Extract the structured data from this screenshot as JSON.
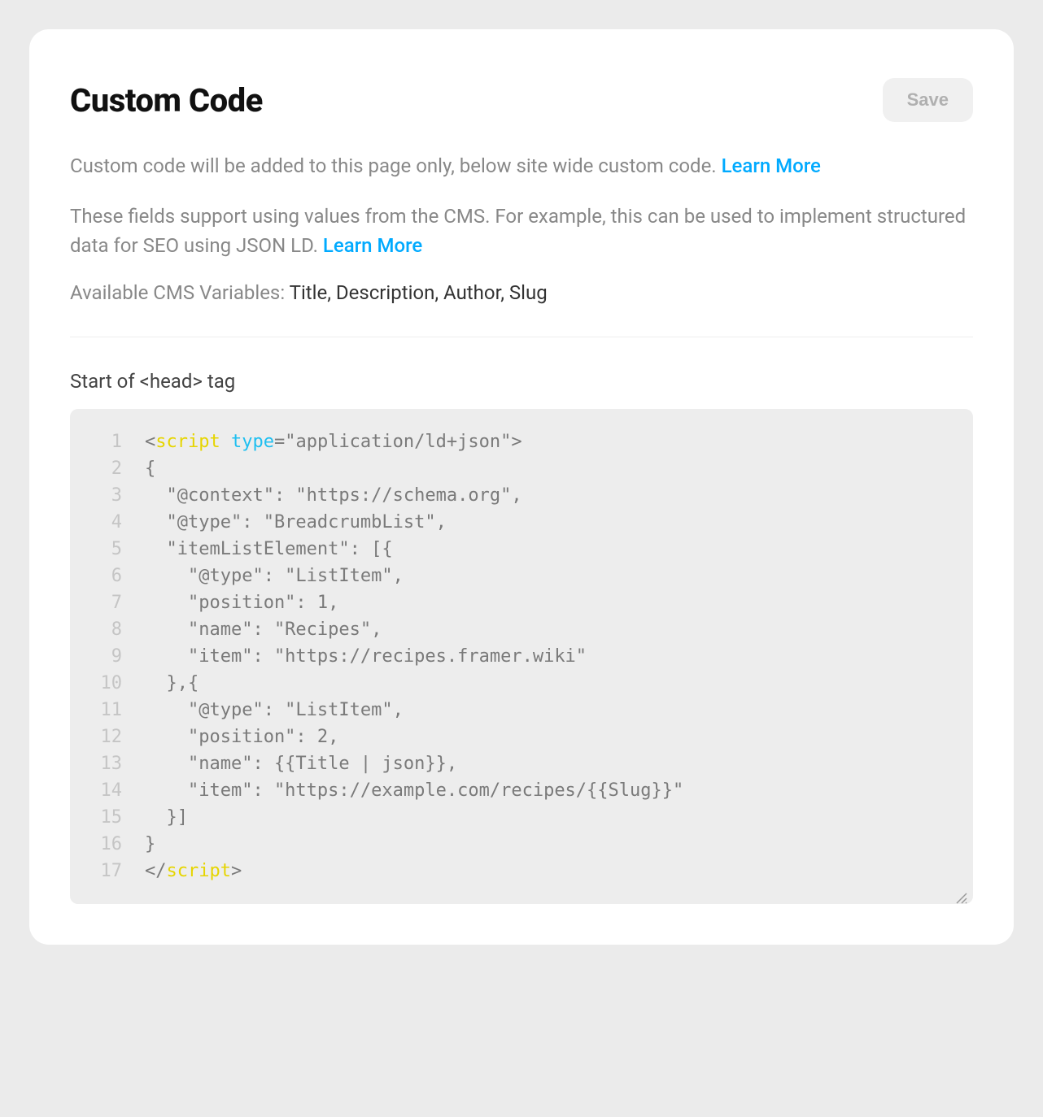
{
  "header": {
    "title": "Custom Code",
    "save_label": "Save"
  },
  "descriptions": {
    "line1": "Custom code will be added to this page only, below site wide custom code. ",
    "learn_more_1": "Learn More",
    "line2": "These fields support using values from the CMS. For example, this can be used to implement structured data for SEO using JSON LD. ",
    "learn_more_2": "Learn More"
  },
  "cms_vars": {
    "label": "Available CMS Variables: ",
    "value": "Title, Description, Author, Slug"
  },
  "section_label": "Start of <head> tag",
  "code": {
    "lines": [
      {
        "n": "1",
        "segments": [
          {
            "t": "<",
            "c": "plain"
          },
          {
            "t": "script",
            "c": "tag"
          },
          {
            "t": " ",
            "c": "plain"
          },
          {
            "t": "type",
            "c": "attr"
          },
          {
            "t": "=\"application/ld+json\">",
            "c": "plain"
          }
        ]
      },
      {
        "n": "2",
        "segments": [
          {
            "t": "{",
            "c": "plain"
          }
        ]
      },
      {
        "n": "3",
        "segments": [
          {
            "t": "  \"@context\": \"https://schema.org\",",
            "c": "plain"
          }
        ]
      },
      {
        "n": "4",
        "segments": [
          {
            "t": "  \"@type\": \"BreadcrumbList\",",
            "c": "plain"
          }
        ]
      },
      {
        "n": "5",
        "segments": [
          {
            "t": "  \"itemListElement\": [{",
            "c": "plain"
          }
        ]
      },
      {
        "n": "6",
        "segments": [
          {
            "t": "    \"@type\": \"ListItem\",",
            "c": "plain"
          }
        ]
      },
      {
        "n": "7",
        "segments": [
          {
            "t": "    \"position\": 1,",
            "c": "plain"
          }
        ]
      },
      {
        "n": "8",
        "segments": [
          {
            "t": "    \"name\": \"Recipes\",",
            "c": "plain"
          }
        ]
      },
      {
        "n": "9",
        "segments": [
          {
            "t": "    \"item\": \"https://recipes.framer.wiki\"",
            "c": "plain"
          }
        ]
      },
      {
        "n": "10",
        "segments": [
          {
            "t": "  },{",
            "c": "plain"
          }
        ]
      },
      {
        "n": "11",
        "segments": [
          {
            "t": "    \"@type\": \"ListItem\",",
            "c": "plain"
          }
        ]
      },
      {
        "n": "12",
        "segments": [
          {
            "t": "    \"position\": 2,",
            "c": "plain"
          }
        ]
      },
      {
        "n": "13",
        "segments": [
          {
            "t": "    \"name\": {{Title | json}},",
            "c": "plain"
          }
        ]
      },
      {
        "n": "14",
        "segments": [
          {
            "t": "    \"item\": \"https://example.com/recipes/{{Slug}}\"",
            "c": "plain"
          }
        ]
      },
      {
        "n": "15",
        "segments": [
          {
            "t": "  }]",
            "c": "plain"
          }
        ]
      },
      {
        "n": "16",
        "segments": [
          {
            "t": "}",
            "c": "plain"
          }
        ]
      },
      {
        "n": "17",
        "segments": [
          {
            "t": "</",
            "c": "plain"
          },
          {
            "t": "script",
            "c": "tag"
          },
          {
            "t": ">",
            "c": "plain"
          }
        ]
      }
    ]
  }
}
